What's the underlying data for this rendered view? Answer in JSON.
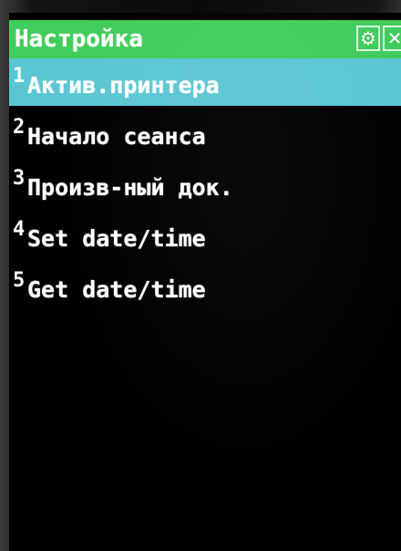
{
  "header": {
    "title": "Настройка",
    "icons": [
      "settings-icon",
      "close-icon"
    ]
  },
  "menu": {
    "items": [
      {
        "number": "1",
        "label": "Актив.принтера",
        "selected": true
      },
      {
        "number": "2",
        "label": "Начало сеанса",
        "selected": false
      },
      {
        "number": "3",
        "label": "Произв-ный док.",
        "selected": false
      },
      {
        "number": "4",
        "label": "Set date/time",
        "selected": false
      },
      {
        "number": "5",
        "label": "Get date/time",
        "selected": false
      }
    ]
  },
  "colors": {
    "titlebar": "#41cc5c",
    "selection": "#5bc7d3",
    "background": "#000000",
    "text": "#ffffff"
  }
}
